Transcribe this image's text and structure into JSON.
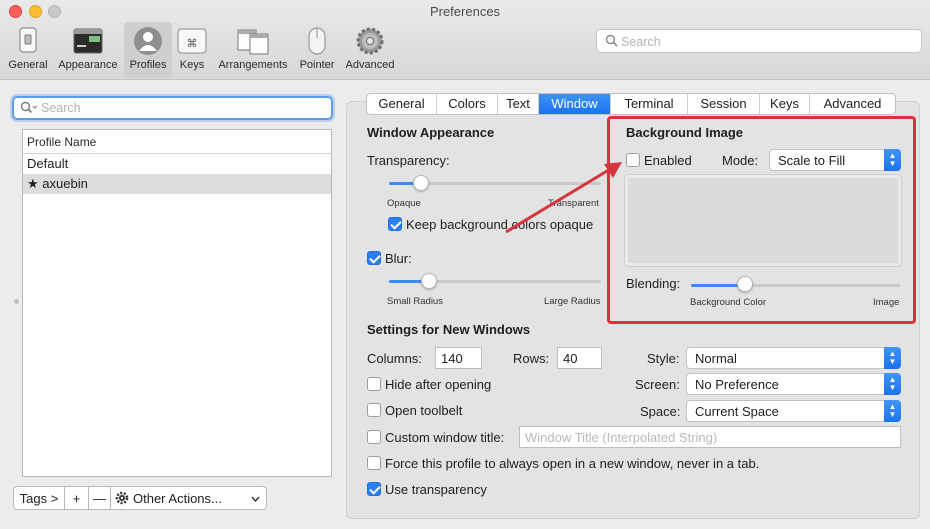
{
  "window": {
    "title": "Preferences"
  },
  "toolbar": {
    "items": [
      {
        "label": "General",
        "icon": "general-icon"
      },
      {
        "label": "Appearance",
        "icon": "appearance-icon"
      },
      {
        "label": "Profiles",
        "icon": "profiles-icon",
        "selected": true
      },
      {
        "label": "Keys",
        "icon": "keys-icon"
      },
      {
        "label": "Arrangements",
        "icon": "arrangements-icon"
      },
      {
        "label": "Pointer",
        "icon": "pointer-icon"
      },
      {
        "label": "Advanced",
        "icon": "advanced-gear-icon"
      }
    ],
    "search_placeholder": "Search"
  },
  "profiles": {
    "search_placeholder": "Search",
    "column_header": "Profile Name",
    "rows": [
      {
        "name": "Default",
        "selected": false,
        "default_marker": ""
      },
      {
        "name": "axuebin",
        "selected": true,
        "default_marker": "★"
      }
    ],
    "bottom": {
      "tags": "Tags >",
      "add": "+",
      "remove": "—",
      "other_actions": "Other Actions..."
    }
  },
  "tabs": [
    "General",
    "Colors",
    "Text",
    "Window",
    "Terminal",
    "Session",
    "Keys",
    "Advanced"
  ],
  "active_tab": "Window",
  "window_appearance": {
    "heading": "Window Appearance",
    "transparency_label": "Transparency:",
    "transparency_value": 0.15,
    "transparency_min": "Opaque",
    "transparency_max": "Transparent",
    "keep_bg_opaque_label": "Keep background colors opaque",
    "keep_bg_opaque_checked": true,
    "blur_label": "Blur:",
    "blur_checked": true,
    "blur_value": 0.19,
    "blur_min": "Small Radius",
    "blur_max": "Large Radius"
  },
  "background_image": {
    "heading": "Background Image",
    "enabled_label": "Enabled",
    "enabled_checked": false,
    "mode_label": "Mode:",
    "mode_value": "Scale to Fill",
    "blending_label": "Blending:",
    "blending_value": 0.26,
    "blending_min": "Background Color",
    "blending_max": "Image"
  },
  "new_windows": {
    "heading": "Settings for New Windows",
    "columns_label": "Columns:",
    "columns_value": "140",
    "rows_label": "Rows:",
    "rows_value": "40",
    "style_label": "Style:",
    "style_value": "Normal",
    "screen_label": "Screen:",
    "screen_value": "No Preference",
    "space_label": "Space:",
    "space_value": "Current Space",
    "hide_after_opening_label": "Hide after opening",
    "hide_after_opening_checked": false,
    "open_toolbelt_label": "Open toolbelt",
    "open_toolbelt_checked": false,
    "custom_title_label": "Custom window title:",
    "custom_title_checked": false,
    "custom_title_placeholder": "Window Title (Interpolated String)",
    "force_new_window_label": "Force this profile to always open in a new window, never in a tab.",
    "force_new_window_checked": false,
    "use_transparency_label": "Use transparency",
    "use_transparency_checked": true
  },
  "colors": {
    "accent": "#2c7ef4",
    "annotation": "#d6343c"
  }
}
